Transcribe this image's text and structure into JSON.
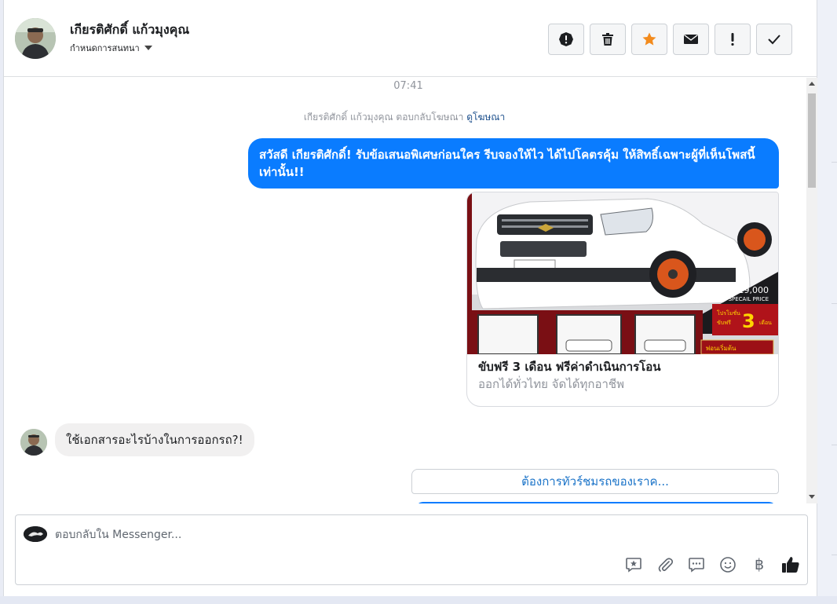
{
  "header": {
    "contact_name": "เกียรติศักดิ์ แก้วมุงคุณ",
    "conversation_setting": "กำหนดการสนทนา",
    "actions": [
      {
        "name": "spam",
        "icon": "exclamation-circle-icon"
      },
      {
        "name": "delete",
        "icon": "trash-icon"
      },
      {
        "name": "star",
        "icon": "star-icon"
      },
      {
        "name": "mark-unread",
        "icon": "envelope-icon"
      },
      {
        "name": "important",
        "icon": "exclamation-icon"
      },
      {
        "name": "done",
        "icon": "check-icon"
      }
    ],
    "colors": {
      "star": "#f38b1d"
    }
  },
  "messages": {
    "timestamp": "07:41",
    "system_text": "เกียรติศักดิ์ แก้วมุงคุณ ตอบกลับโฆษณา",
    "system_link": "ดูโฆษณา",
    "outgoing_text": "สวัสดี เกียรติศักดิ์! รับข้อเสนอพิเศษก่อนใคร รีบจองให้ไว ได้ไปโคตรคุ้ม ให้สิทธิ์เฉพาะผู้ที่เห็นโพสนี้เท่านั้น!!",
    "ad_card": {
      "title": "ขับฟรี 3 เดือน ฟรีค่าดำเนินการโอน",
      "subtitle": "ออกได้ทั่วไทย จัดได้ทุกอาชีพ",
      "image_price": "319,000",
      "image_price_label": "SPECAIL PRICE",
      "image_promo_top": "โปรโมชั่น",
      "image_promo_mid": "ขับฟรี",
      "image_promo_number": "3",
      "image_promo_unit": "เดือน",
      "image_bottom_label": "พ่อนเริ่มต้น"
    },
    "incoming_text": "ใช้เอกสารอะไรบ้างในการออกรถ?!",
    "quick_reply": "ต้องการทัวร์ชมรถของเราค...",
    "colors": {
      "outgoing": "#0a7cff",
      "incoming": "#f1f0f0",
      "link": "#1a73c8"
    }
  },
  "composer": {
    "placeholder": "ตอบกลับใน Messenger...",
    "tools": [
      "saved-reply-icon",
      "attachment-icon",
      "chat-bubble-icon",
      "emoji-icon",
      "baht-icon",
      "thumbs-up-icon"
    ],
    "baht_symbol": "฿"
  }
}
